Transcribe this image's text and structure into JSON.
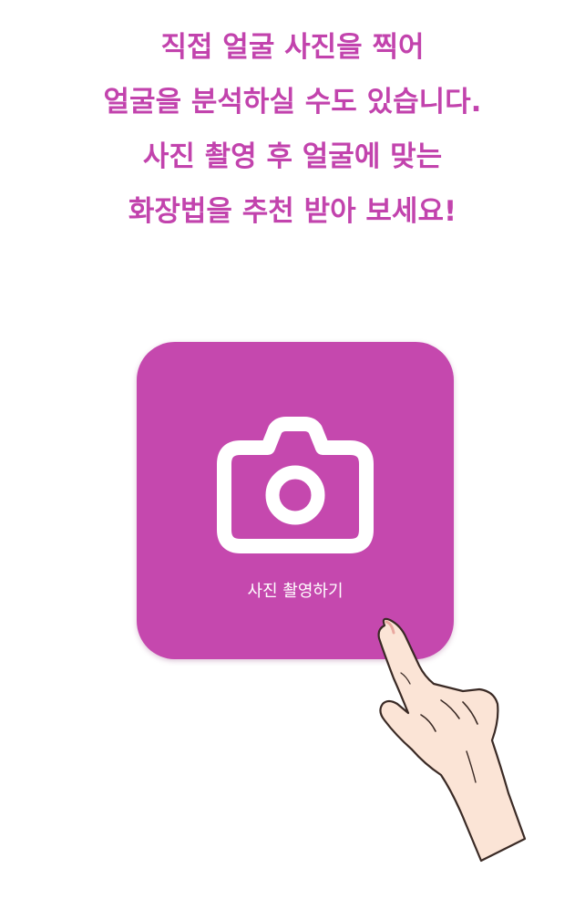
{
  "headline": {
    "lines": [
      "직접 얼굴 사진을 찍어",
      "얼굴을 분석하실 수도 있습니다.",
      "사진 촬영 후 얼굴에 맞는",
      "화장법을 추천 받아 보세요!"
    ]
  },
  "capture_button": {
    "label": "사진 촬영하기",
    "icon": "camera-icon",
    "color": "#c548ae"
  },
  "accent_color": "#c243ad",
  "illustration": {
    "icon": "pointing-hand"
  }
}
